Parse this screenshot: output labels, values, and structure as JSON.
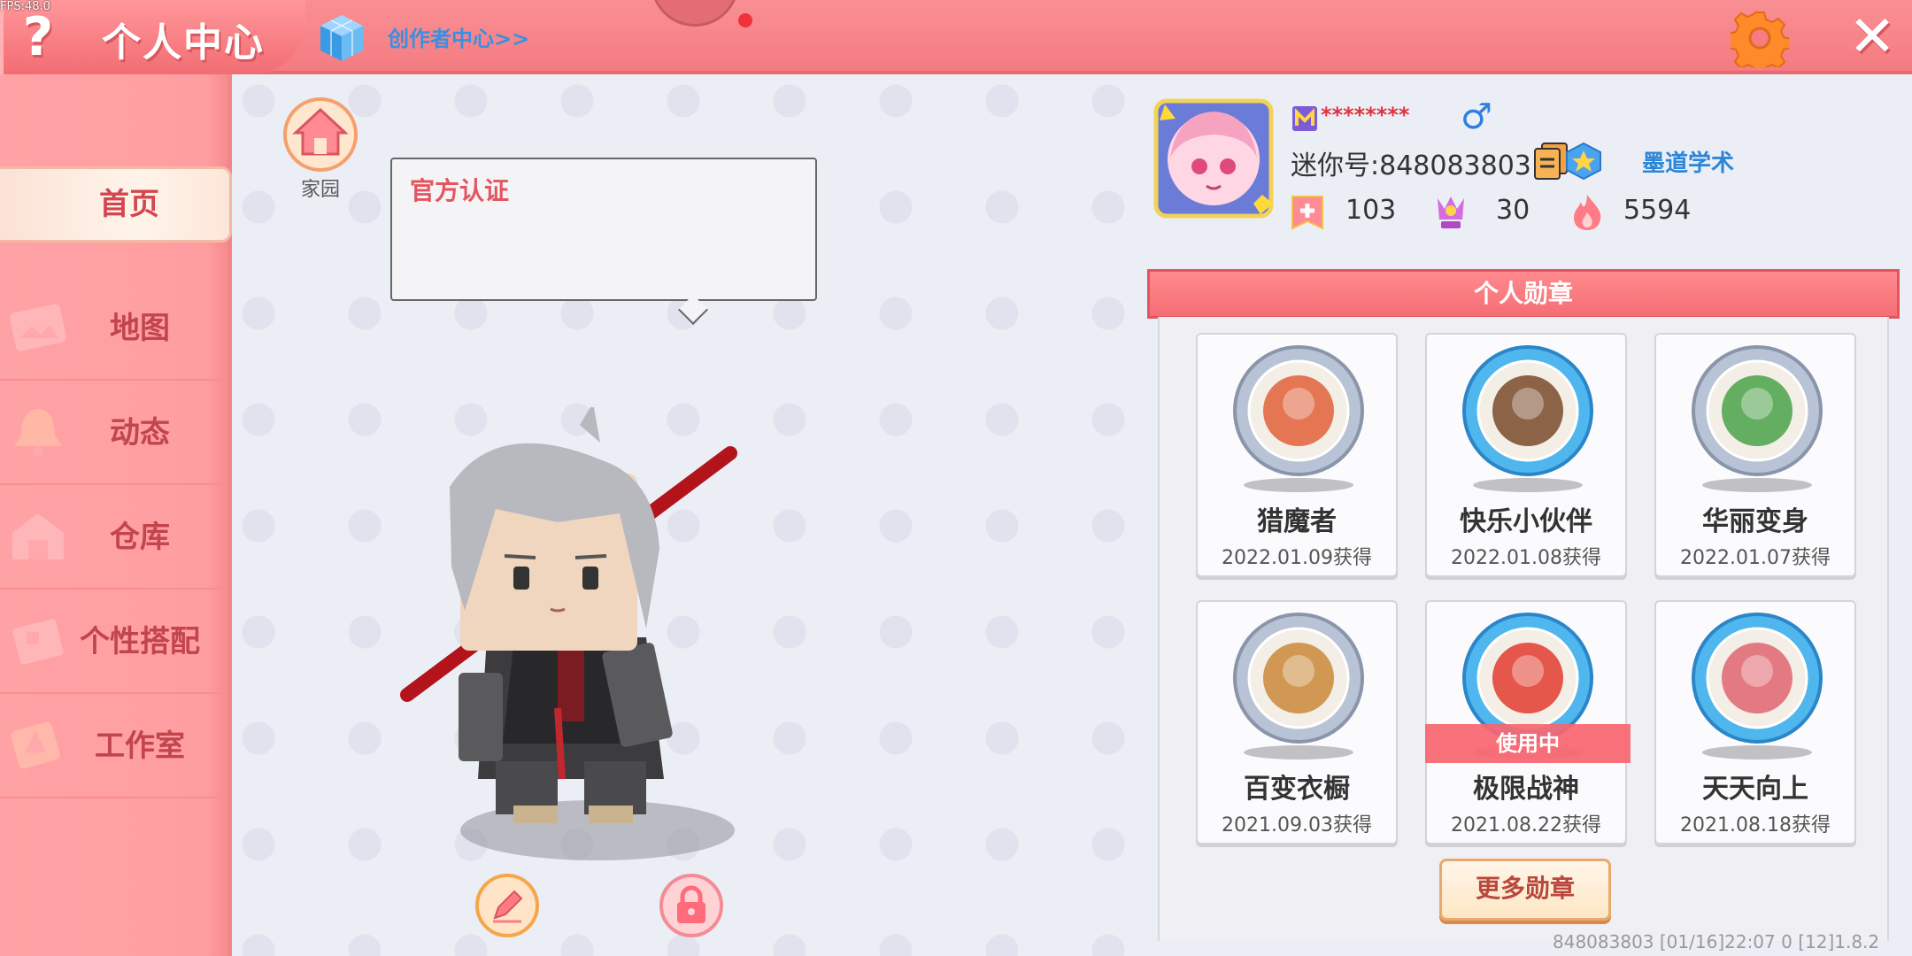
{
  "fps": "FPS:48.0",
  "header": {
    "help_label": "?",
    "title": "个人中心",
    "creator_link": "创作者中心>>",
    "close_label": "✕"
  },
  "sidebar": {
    "items": [
      {
        "label": "首页",
        "active": true
      },
      {
        "label": "地图"
      },
      {
        "label": "动态"
      },
      {
        "label": "仓库"
      },
      {
        "label": "个性搭配"
      },
      {
        "label": "工作室"
      }
    ]
  },
  "center": {
    "home_label": "家园",
    "bubble_title": "官方认证"
  },
  "profile": {
    "nickname": "********",
    "gender_symbol": "♂",
    "mini_id": "迷你号:848083803",
    "guild": "墨道学术",
    "stats": [
      "103",
      "30",
      "5594"
    ]
  },
  "medals": {
    "header": "个人勋章",
    "items": [
      {
        "name": "猎魔者",
        "date": "2022.01.09获得",
        "frame": "silver",
        "accent": "#e2603a"
      },
      {
        "name": "快乐小伙伴",
        "date": "2022.01.08获得",
        "frame": "blue",
        "accent": "#7a4a2a"
      },
      {
        "name": "华丽变身",
        "date": "2022.01.07获得",
        "frame": "silver",
        "accent": "#4aa24a"
      },
      {
        "name": "百变衣橱",
        "date": "2021.09.03获得",
        "frame": "silver",
        "accent": "#c98838"
      },
      {
        "name": "极限战神",
        "date": "2021.08.22获得",
        "frame": "blue",
        "accent": "#e23b2f",
        "in_use": "使用中"
      },
      {
        "name": "天天向上",
        "date": "2021.08.18获得",
        "frame": "blue",
        "accent": "#e0656f"
      }
    ],
    "more_label": "更多勋章"
  },
  "footer": "848083803    [01/16]22:07 0  [12]1.8.2",
  "colors": {
    "topbar": "#f47c82",
    "sidebar": "#ff9ea1",
    "active_tab": "#fff4ea",
    "accent_red": "#e0323d",
    "link_blue": "#3a8fe0"
  }
}
